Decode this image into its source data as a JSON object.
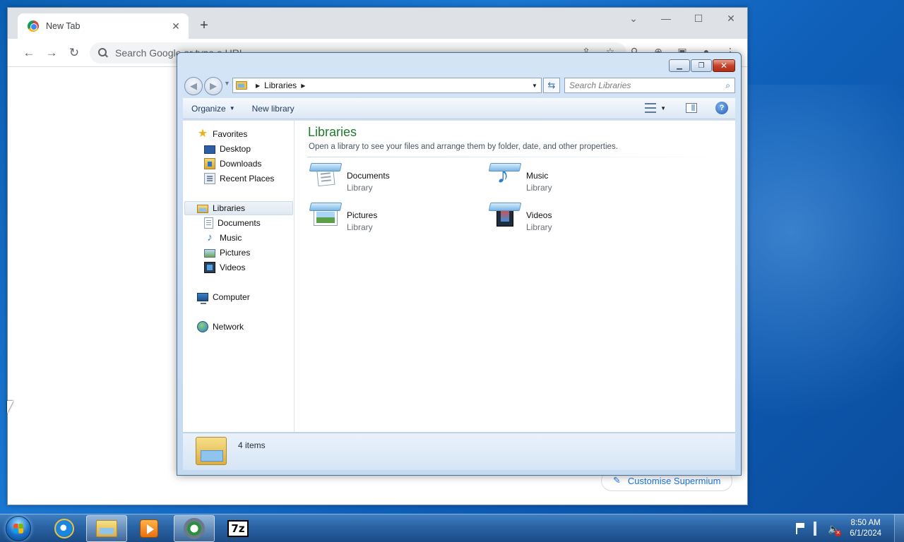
{
  "browser": {
    "tab_title": "New Tab",
    "tab_close": "✕",
    "new_tab": "+",
    "omnibox_placeholder": "Search Google or type a URL",
    "customise_label": "Customise Supermium"
  },
  "explorer": {
    "breadcrumb": "Libraries",
    "search_placeholder": "Search Libraries",
    "commands": {
      "organize": "Organize",
      "new_library": "New library"
    },
    "help": "?",
    "nav": {
      "favorites": "Favorites",
      "desktop": "Desktop",
      "downloads": "Downloads",
      "recent_places": "Recent Places",
      "libraries": "Libraries",
      "documents": "Documents",
      "music": "Music",
      "pictures": "Pictures",
      "videos": "Videos",
      "computer": "Computer",
      "network": "Network"
    },
    "heading": "Libraries",
    "subheading": "Open a library to see your files and arrange them by folder, date, and other properties.",
    "libraries": [
      {
        "name": "Documents",
        "type": "Library",
        "icon": "documents-library-icon"
      },
      {
        "name": "Music",
        "type": "Library",
        "icon": "music-library-icon"
      },
      {
        "name": "Pictures",
        "type": "Library",
        "icon": "pictures-library-icon"
      },
      {
        "name": "Videos",
        "type": "Library",
        "icon": "videos-library-icon"
      }
    ],
    "item_count": "4 items"
  },
  "taskbar": {
    "seven_zip_label": "7z",
    "clock_time": "8:50 AM",
    "clock_date": "6/1/2024"
  }
}
